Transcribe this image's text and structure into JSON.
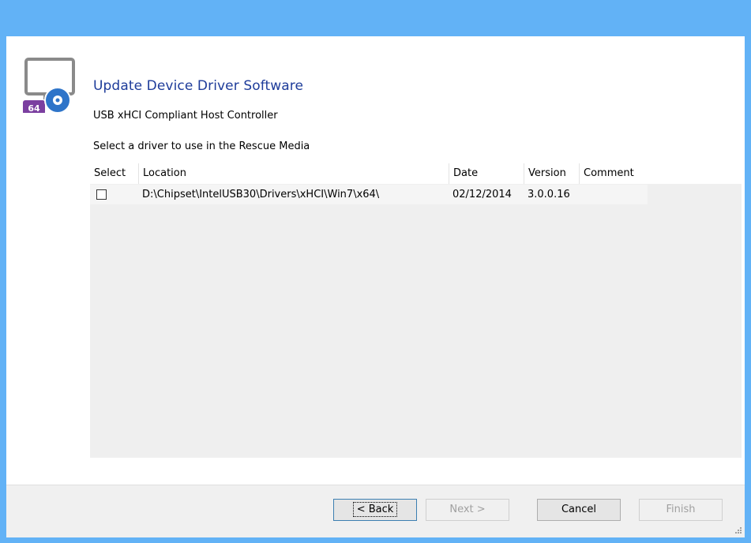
{
  "header": {
    "title": "Update Device Driver Software",
    "subtitle": "USB xHCI Compliant Host Controller",
    "badge": "64",
    "icons": [
      "monitor-icon",
      "disc-icon"
    ]
  },
  "section": {
    "label": "Select a driver to use in the Rescue Media"
  },
  "table": {
    "columns": [
      "Select",
      "Location",
      "Date",
      "Version",
      "Comment"
    ],
    "rows": [
      {
        "selected": false,
        "location": "D:\\Chipset\\IntelUSB30\\Drivers\\xHCI\\Win7\\x64\\",
        "date": "02/12/2014",
        "version": "3.0.0.16",
        "comment": ""
      }
    ]
  },
  "buttons": {
    "back": "< Back",
    "next": "Next >",
    "cancel": "Cancel",
    "finish": "Finish"
  },
  "colors": {
    "title_bar": "#62b2f6",
    "title_text": "#1e3c9a",
    "badge": "#7b3fa0"
  }
}
